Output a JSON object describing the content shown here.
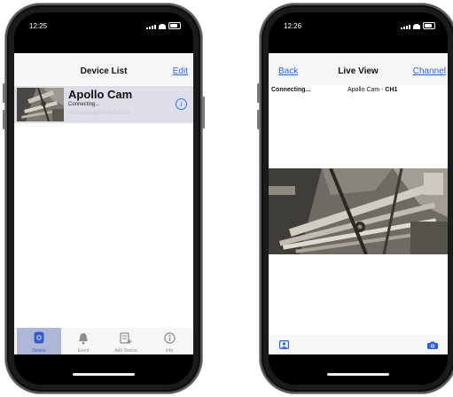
{
  "left_phone": {
    "status_time": "12:25",
    "nav": {
      "title": "Device List",
      "edit_label": "Edit"
    },
    "device": {
      "name": "Apollo Cam",
      "status": "Connecting...",
      "uid": "Ncbmbmdagv5b4h3e111a"
    },
    "tabs": [
      {
        "label": "Device",
        "icon": "device-icon",
        "active": true
      },
      {
        "label": "Event",
        "icon": "bell-icon",
        "active": false
      },
      {
        "label": "Add Device",
        "icon": "add-device-icon",
        "active": false
      },
      {
        "label": "Info",
        "icon": "info-icon",
        "active": false
      }
    ]
  },
  "right_phone": {
    "status_time": "12:26",
    "nav": {
      "back_label": "Back",
      "title": "Live View",
      "channel_label": "Channel"
    },
    "connection_status": "Connecting...",
    "camera_name": "Apollo Cam -",
    "channel": "CH1",
    "toolbar": {
      "left_icon": "contacts-icon",
      "right_icon": "camera-icon"
    }
  },
  "colors": {
    "accent": "#2f62d9",
    "selected_row": "#dedee8",
    "active_tab": "#aeb7d6",
    "bar_bg": "#f6f6f6"
  }
}
